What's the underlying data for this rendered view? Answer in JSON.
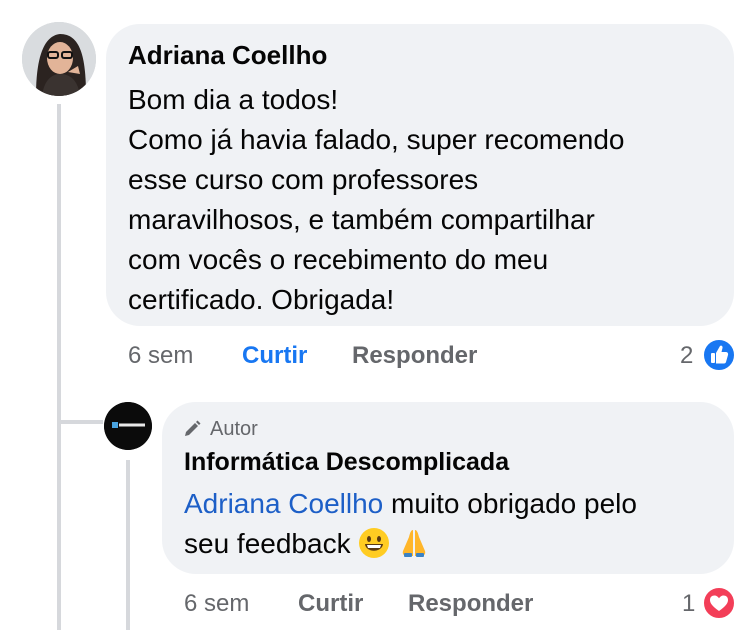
{
  "comment": {
    "author": "Adriana Coellho",
    "lines": [
      "Bom dia a todos!",
      "Como já havia falado, super recomendo",
      "esse curso com professores",
      "maravilhosos, e também compartilhar",
      "com vocês o recebimento do meu",
      "certificado. Obrigada!"
    ],
    "time": "6 sem",
    "like_label": "Curtir",
    "reply_label": "Responder",
    "reaction_count": "2",
    "reaction_icon": "like-icon",
    "liked": true
  },
  "reply": {
    "badge": "Autor",
    "author": "Informática Descomplicada",
    "avatar_text": "INFORMÁTICA",
    "mention": "Adriana Coellho",
    "text_after_mention": " muito obrigado pelo",
    "line2": "seu feedback",
    "emojis": [
      "grinning-face-emoji",
      "folded-hands-emoji"
    ],
    "time": "6 sem",
    "like_label": "Curtir",
    "reply_label": "Responder",
    "reaction_count": "1",
    "reaction_icon": "love-icon"
  },
  "colors": {
    "bubble": "#f0f2f5",
    "link": "#1877f2",
    "muted": "#65676b",
    "love": "#f33e58"
  }
}
